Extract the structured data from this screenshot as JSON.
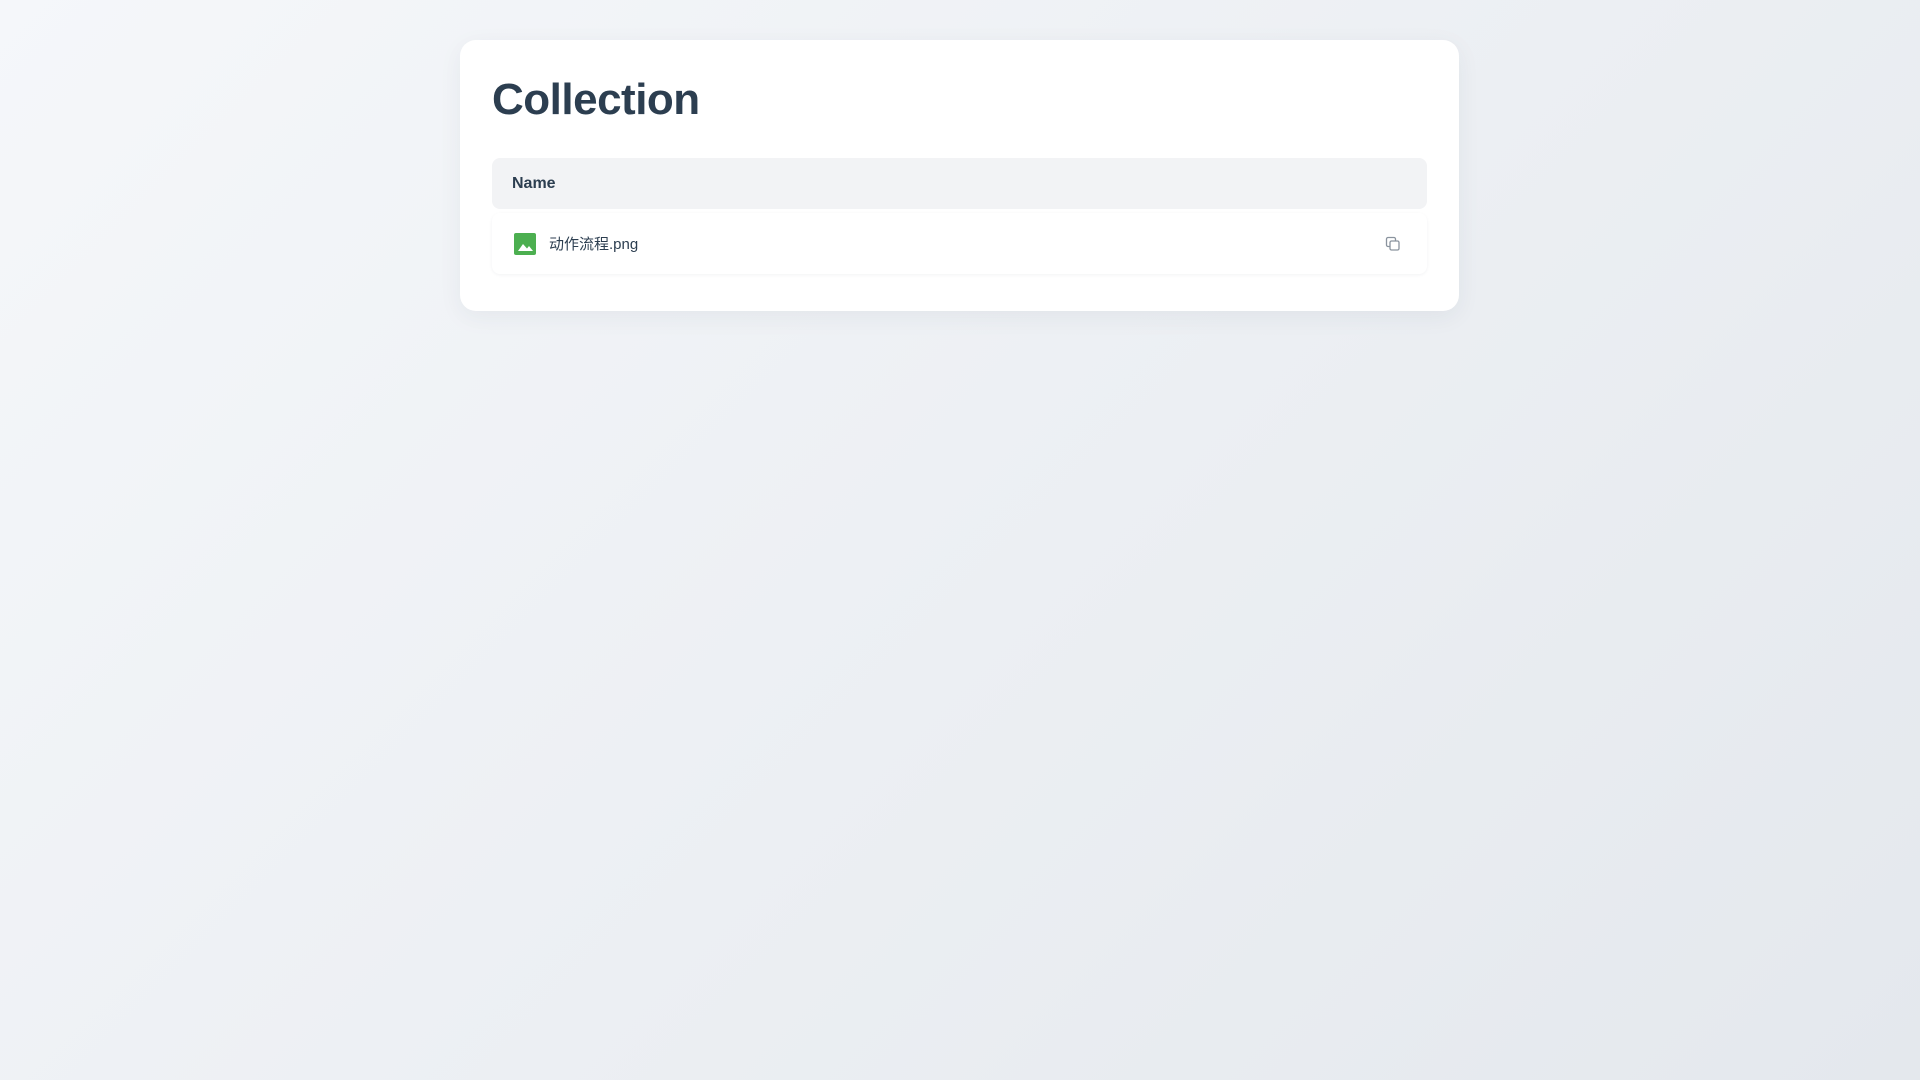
{
  "page": {
    "title": "Collection"
  },
  "table": {
    "columns": [
      "Name"
    ],
    "rows": [
      {
        "name": "动作流程.png",
        "icon": "image-file-icon",
        "action_icon": "copy-icon"
      }
    ]
  },
  "colors": {
    "title": "#2c3e50",
    "header_bg": "#f2f3f5",
    "image_icon": "#4caf50",
    "copy_icon": "#8a939e"
  }
}
